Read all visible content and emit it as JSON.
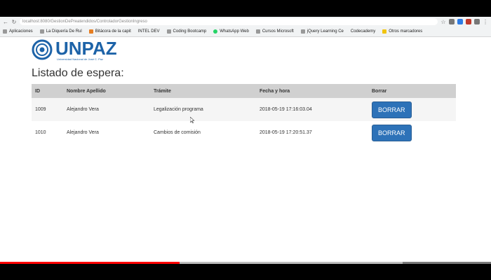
{
  "browser": {
    "url": "localhost:8080/GestionDePreatendidos/ControladorGestionIngreso",
    "bookmarks": [
      "Aplicaciones",
      "La Diquería De Rul",
      "Bitácora de la capit",
      "INTEL DEV",
      "Coding Bootcamp",
      "WhatsApp Web",
      "Cursos Microsoft",
      "jQuery Learning Ce",
      "Codecademy",
      "Otros marcadores"
    ]
  },
  "logo": {
    "name": "UNPAZ",
    "subtitle": "Universidad Nacional de José C. Paz",
    "color": "#1d63a8"
  },
  "page": {
    "title": "Listado de espera:"
  },
  "table": {
    "headers": [
      "ID",
      "Nombre Apellido",
      "Trámite",
      "Fecha y hora",
      "Borrar"
    ],
    "rows": [
      {
        "id": "1009",
        "name": "Alejandro Vera",
        "tramite": "Legalización programa",
        "fecha": "2018-05-19 17:16:03.04",
        "action": "BORRAR"
      },
      {
        "id": "1010",
        "name": "Alejandro Vera",
        "tramite": "Cambios de comisión",
        "fecha": "2018-05-19 17:20:51.37",
        "action": "BORRAR"
      }
    ]
  },
  "video": {
    "progress": 0.365,
    "loaded": 0.82
  }
}
